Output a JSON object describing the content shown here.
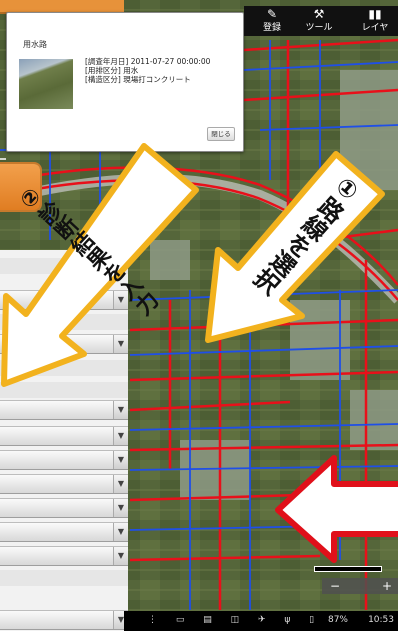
{
  "toolbar": {
    "items": [
      {
        "label": "登録",
        "icon": "pencil-icon"
      },
      {
        "label": "ツール",
        "icon": "wrench-icon"
      },
      {
        "label": "レイヤ",
        "icon": "layers-icon"
      }
    ]
  },
  "popup": {
    "title": "用水路",
    "line1": "[調査年月日] 2011-07-27 00:00:00",
    "line2": "[用排区分] 用水",
    "line3": "[構造区分] 現場打コンクリート",
    "close_label": "閉じる"
  },
  "annotations": {
    "step1": "①路線を選択",
    "step2": "②診断結果を入力"
  },
  "statusbar": {
    "battery": "87%",
    "time": "10:53"
  },
  "colors": {
    "road_red": "#e8101a",
    "road_blue": "#1f4fe8",
    "arrow_fill": "#ffffff",
    "arrow_border": "#f2b21e",
    "big_arrow_border": "#e0101a"
  }
}
